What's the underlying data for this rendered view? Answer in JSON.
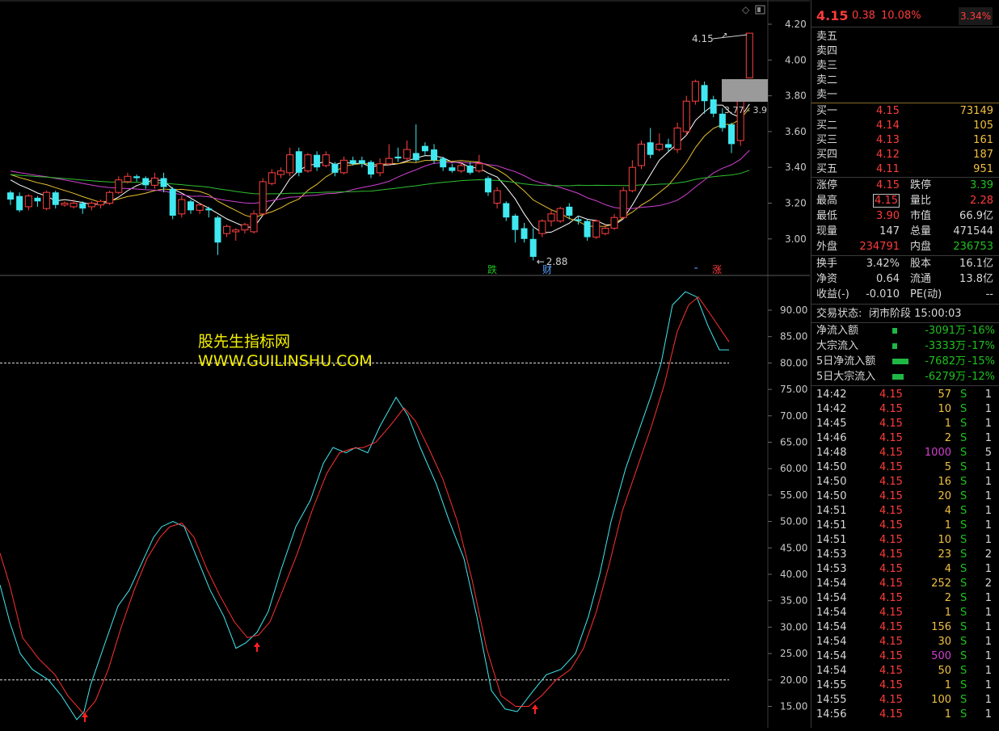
{
  "quote": {
    "price": "4.15",
    "change": "0.38",
    "pct": "10.08%",
    "top_right": "3.34%"
  },
  "asks": [
    {
      "label": "卖五"
    },
    {
      "label": "卖四"
    },
    {
      "label": "卖三"
    },
    {
      "label": "卖二"
    },
    {
      "label": "卖一"
    }
  ],
  "bids": [
    {
      "label": "买一",
      "price": "4.15",
      "vol": "73149"
    },
    {
      "label": "买二",
      "price": "4.14",
      "vol": "105"
    },
    {
      "label": "买三",
      "price": "4.13",
      "vol": "161"
    },
    {
      "label": "买四",
      "price": "4.12",
      "vol": "187"
    },
    {
      "label": "买五",
      "price": "4.11",
      "vol": "951"
    }
  ],
  "stats": [
    {
      "l1": "涨停",
      "v1": "4.15",
      "l2": "跌停",
      "v2": "3.39"
    },
    {
      "l1": "最高",
      "v1": "4.15",
      "l2": "量比",
      "v2": "2.28"
    },
    {
      "l1": "最低",
      "v1": "3.90",
      "l2": "市值",
      "v2": "66.9亿"
    },
    {
      "l1": "现量",
      "v1": "147",
      "l2": "总量",
      "v2": "471544"
    },
    {
      "l1": "外盘",
      "v1": "234791",
      "l2": "内盘",
      "v2": "236753"
    }
  ],
  "stats2": [
    {
      "l1": "换手",
      "v1": "3.42%",
      "l2": "股本",
      "v2": "16.1亿"
    },
    {
      "l1": "净资",
      "v1": "0.64",
      "l2": "流通",
      "v2": "13.8亿"
    },
    {
      "l1": "收益(-)",
      "v1": "-0.010",
      "l2": "PE(动)",
      "v2": "--"
    }
  ],
  "status": {
    "label": "交易状态:",
    "value": "闭市阶段 15:00:03"
  },
  "flows": [
    {
      "label": "净流入额",
      "value": "-3091万",
      "pct": "-16%",
      "bar": 0.16
    },
    {
      "label": "大宗流入",
      "value": "-3333万",
      "pct": "-17%",
      "bar": 0.17
    },
    {
      "label": "5日净流入额",
      "value": "-7682万",
      "pct": "-15%",
      "bar": 0.85
    },
    {
      "label": "5日大宗流入",
      "value": "-6279万",
      "pct": "-12%",
      "bar": 0.6
    }
  ],
  "ticks": [
    {
      "t": "14:42",
      "p": "4.15",
      "v": "57",
      "s": "S",
      "n": "1"
    },
    {
      "t": "14:42",
      "p": "4.15",
      "v": "10",
      "s": "S",
      "n": "1"
    },
    {
      "t": "14:45",
      "p": "4.15",
      "v": "1",
      "s": "S",
      "n": "1"
    },
    {
      "t": "14:46",
      "p": "4.15",
      "v": "2",
      "s": "S",
      "n": "1"
    },
    {
      "t": "14:48",
      "p": "4.15",
      "v": "1000",
      "s": "S",
      "n": "5"
    },
    {
      "t": "14:50",
      "p": "4.15",
      "v": "5",
      "s": "S",
      "n": "1"
    },
    {
      "t": "14:50",
      "p": "4.15",
      "v": "16",
      "s": "S",
      "n": "1"
    },
    {
      "t": "14:50",
      "p": "4.15",
      "v": "20",
      "s": "S",
      "n": "1"
    },
    {
      "t": "14:51",
      "p": "4.15",
      "v": "4",
      "s": "S",
      "n": "1"
    },
    {
      "t": "14:51",
      "p": "4.15",
      "v": "1",
      "s": "S",
      "n": "1"
    },
    {
      "t": "14:51",
      "p": "4.15",
      "v": "10",
      "s": "S",
      "n": "1"
    },
    {
      "t": "14:53",
      "p": "4.15",
      "v": "23",
      "s": "S",
      "n": "2"
    },
    {
      "t": "14:53",
      "p": "4.15",
      "v": "4",
      "s": "S",
      "n": "1"
    },
    {
      "t": "14:54",
      "p": "4.15",
      "v": "252",
      "s": "S",
      "n": "2"
    },
    {
      "t": "14:54",
      "p": "4.15",
      "v": "2",
      "s": "S",
      "n": "1"
    },
    {
      "t": "14:54",
      "p": "4.15",
      "v": "1",
      "s": "S",
      "n": "1"
    },
    {
      "t": "14:54",
      "p": "4.15",
      "v": "156",
      "s": "S",
      "n": "1"
    },
    {
      "t": "14:54",
      "p": "4.15",
      "v": "30",
      "s": "S",
      "n": "1"
    },
    {
      "t": "14:54",
      "p": "4.15",
      "v": "500",
      "s": "S",
      "n": "1"
    },
    {
      "t": "14:54",
      "p": "4.15",
      "v": "50",
      "s": "S",
      "n": "1"
    },
    {
      "t": "14:55",
      "p": "4.15",
      "v": "1",
      "s": "S",
      "n": "1"
    },
    {
      "t": "14:55",
      "p": "4.15",
      "v": "100",
      "s": "S",
      "n": "1"
    },
    {
      "t": "14:56",
      "p": "4.15",
      "v": "1",
      "s": "S",
      "n": "1"
    }
  ],
  "watermark": {
    "line1": "股先生指标网",
    "line2": "WWW.GUILINSHU.COM"
  },
  "price_chart": {
    "y_ticks": [
      "4.20",
      "4.00",
      "3.80",
      "3.60",
      "3.40",
      "3.20",
      "3.00"
    ],
    "high_label": "4.15",
    "low_label": "2.88",
    "range_label": "3.77 - 3.9",
    "markers": [
      {
        "text": "跌",
        "color": "#20c020"
      },
      {
        "text": "财",
        "color": "#5aa0ff"
      },
      {
        "text": "涨",
        "color": "#ff3b3b"
      }
    ],
    "candles": [
      [
        3.26,
        3.22,
        3.27,
        3.19
      ],
      [
        3.24,
        3.16,
        3.26,
        3.15
      ],
      [
        3.18,
        3.24,
        3.25,
        3.16
      ],
      [
        3.23,
        3.21,
        3.24,
        3.18
      ],
      [
        3.17,
        3.26,
        3.27,
        3.16
      ],
      [
        3.26,
        3.19,
        3.27,
        3.17
      ],
      [
        3.19,
        3.2,
        3.21,
        3.18
      ],
      [
        3.18,
        3.2,
        3.22,
        3.17
      ],
      [
        3.2,
        3.17,
        3.21,
        3.14
      ],
      [
        3.18,
        3.2,
        3.21,
        3.16
      ],
      [
        3.19,
        3.21,
        3.22,
        3.17
      ],
      [
        3.2,
        3.26,
        3.27,
        3.19
      ],
      [
        3.26,
        3.33,
        3.35,
        3.25
      ],
      [
        3.32,
        3.35,
        3.37,
        3.31
      ],
      [
        3.35,
        3.34,
        3.36,
        3.32
      ],
      [
        3.34,
        3.3,
        3.35,
        3.28
      ],
      [
        3.3,
        3.34,
        3.37,
        3.28
      ],
      [
        3.34,
        3.29,
        3.37,
        3.26
      ],
      [
        3.28,
        3.13,
        3.29,
        3.11
      ],
      [
        3.14,
        3.22,
        3.24,
        3.12
      ],
      [
        3.21,
        3.16,
        3.22,
        3.14
      ],
      [
        3.16,
        3.19,
        3.2,
        3.14
      ],
      [
        3.17,
        3.16,
        3.18,
        3.12
      ],
      [
        3.12,
        2.98,
        3.13,
        2.91
      ],
      [
        3.03,
        3.07,
        3.08,
        3.01
      ],
      [
        3.04,
        3.05,
        3.06,
        2.99
      ],
      [
        3.05,
        3.08,
        3.09,
        3.03
      ],
      [
        3.04,
        3.14,
        3.16,
        3.03
      ],
      [
        3.14,
        3.32,
        3.34,
        3.13
      ],
      [
        3.31,
        3.37,
        3.39,
        3.3
      ],
      [
        3.36,
        3.38,
        3.4,
        3.34
      ],
      [
        3.37,
        3.47,
        3.51,
        3.35
      ],
      [
        3.49,
        3.37,
        3.51,
        3.35
      ],
      [
        3.38,
        3.47,
        3.48,
        3.37
      ],
      [
        3.47,
        3.4,
        3.49,
        3.38
      ],
      [
        3.41,
        3.47,
        3.49,
        3.4
      ],
      [
        3.42,
        3.37,
        3.43,
        3.35
      ],
      [
        3.37,
        3.44,
        3.46,
        3.36
      ],
      [
        3.44,
        3.42,
        3.46,
        3.41
      ],
      [
        3.44,
        3.42,
        3.46,
        3.4
      ],
      [
        3.43,
        3.36,
        3.44,
        3.34
      ],
      [
        3.37,
        3.42,
        3.45,
        3.35
      ],
      [
        3.42,
        3.45,
        3.53,
        3.41
      ],
      [
        3.46,
        3.45,
        3.51,
        3.43
      ],
      [
        3.45,
        3.5,
        3.55,
        3.44
      ],
      [
        3.48,
        3.44,
        3.64,
        3.43
      ],
      [
        3.52,
        3.49,
        3.54,
        3.47
      ],
      [
        3.5,
        3.44,
        3.53,
        3.42
      ],
      [
        3.45,
        3.4,
        3.46,
        3.38
      ],
      [
        3.4,
        3.38,
        3.42,
        3.37
      ],
      [
        3.38,
        3.41,
        3.43,
        3.37
      ],
      [
        3.41,
        3.37,
        3.43,
        3.36
      ],
      [
        3.38,
        3.42,
        3.47,
        3.37
      ],
      [
        3.34,
        3.26,
        3.35,
        3.24
      ],
      [
        3.2,
        3.27,
        3.29,
        3.17
      ],
      [
        3.2,
        3.12,
        3.21,
        3.1
      ],
      [
        3.13,
        3.05,
        3.14,
        2.98
      ],
      [
        3.06,
        3.0,
        3.09,
        2.98
      ],
      [
        3.0,
        2.9,
        3.06,
        2.88
      ],
      [
        3.03,
        3.1,
        3.11,
        3.01
      ],
      [
        3.1,
        3.14,
        3.16,
        3.07
      ],
      [
        3.1,
        3.17,
        3.18,
        3.09
      ],
      [
        3.18,
        3.13,
        3.2,
        3.11
      ],
      [
        3.11,
        3.1,
        3.13,
        3.08
      ],
      [
        3.1,
        3.01,
        3.11,
        2.99
      ],
      [
        3.01,
        3.1,
        3.11,
        3.0
      ],
      [
        3.03,
        3.06,
        3.08,
        3.02
      ],
      [
        3.06,
        3.12,
        3.14,
        3.05
      ],
      [
        3.12,
        3.27,
        3.29,
        3.11
      ],
      [
        3.27,
        3.4,
        3.44,
        3.26
      ],
      [
        3.41,
        3.53,
        3.55,
        3.39
      ],
      [
        3.54,
        3.47,
        3.62,
        3.45
      ],
      [
        3.5,
        3.53,
        3.59,
        3.49
      ],
      [
        3.53,
        3.51,
        3.56,
        3.49
      ],
      [
        3.5,
        3.62,
        3.65,
        3.48
      ],
      [
        3.6,
        3.77,
        3.8,
        3.58
      ],
      [
        3.77,
        3.88,
        3.89,
        3.75
      ],
      [
        3.86,
        3.77,
        3.88,
        3.7
      ],
      [
        3.78,
        3.7,
        3.8,
        3.68
      ],
      [
        3.7,
        3.62,
        3.73,
        3.6
      ],
      [
        3.64,
        3.53,
        3.65,
        3.48
      ],
      [
        3.55,
        3.77,
        3.8,
        3.52
      ],
      [
        3.9,
        4.15,
        4.15,
        3.9
      ]
    ]
  },
  "indicator_chart": {
    "y_ticks": [
      "90.00",
      "85.00",
      "80.00",
      "75.00",
      "70.00",
      "65.00",
      "60.00",
      "55.00",
      "50.00",
      "45.00",
      "40.00",
      "35.00",
      "30.00",
      "25.00",
      "20.00",
      "15.00"
    ],
    "ref_lines": [
      80,
      20
    ]
  }
}
